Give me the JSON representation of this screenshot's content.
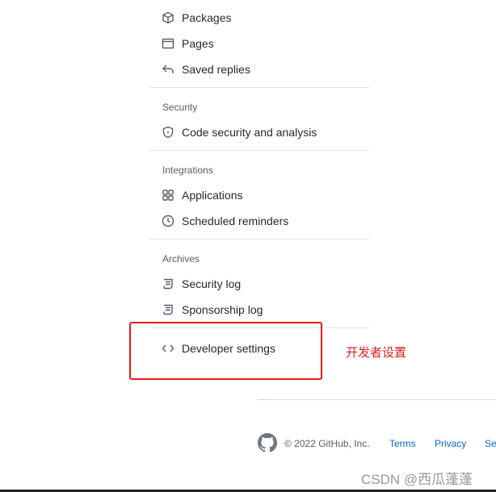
{
  "menu": {
    "items_top": [
      {
        "label": "Packages",
        "icon": "package-icon"
      },
      {
        "label": "Pages",
        "icon": "browser-icon"
      },
      {
        "label": "Saved replies",
        "icon": "reply-icon"
      }
    ],
    "security": {
      "header": "Security",
      "items": [
        {
          "label": "Code security and analysis",
          "icon": "shield-lock-icon"
        }
      ]
    },
    "integrations": {
      "header": "Integrations",
      "items": [
        {
          "label": "Applications",
          "icon": "apps-icon"
        },
        {
          "label": "Scheduled reminders",
          "icon": "clock-icon"
        }
      ]
    },
    "archives": {
      "header": "Archives",
      "items": [
        {
          "label": "Security log",
          "icon": "log-icon"
        },
        {
          "label": "Sponsorship log",
          "icon": "log-icon"
        }
      ]
    },
    "developer": {
      "label": "Developer settings",
      "icon": "code-icon"
    }
  },
  "annotation": {
    "note": "开发者设置",
    "color": "#e0201c"
  },
  "footer": {
    "copyright": "© 2022 GitHub, Inc.",
    "links": [
      "Terms",
      "Privacy",
      "Se"
    ]
  },
  "watermark": "CSDN @西瓜蓬蓬"
}
